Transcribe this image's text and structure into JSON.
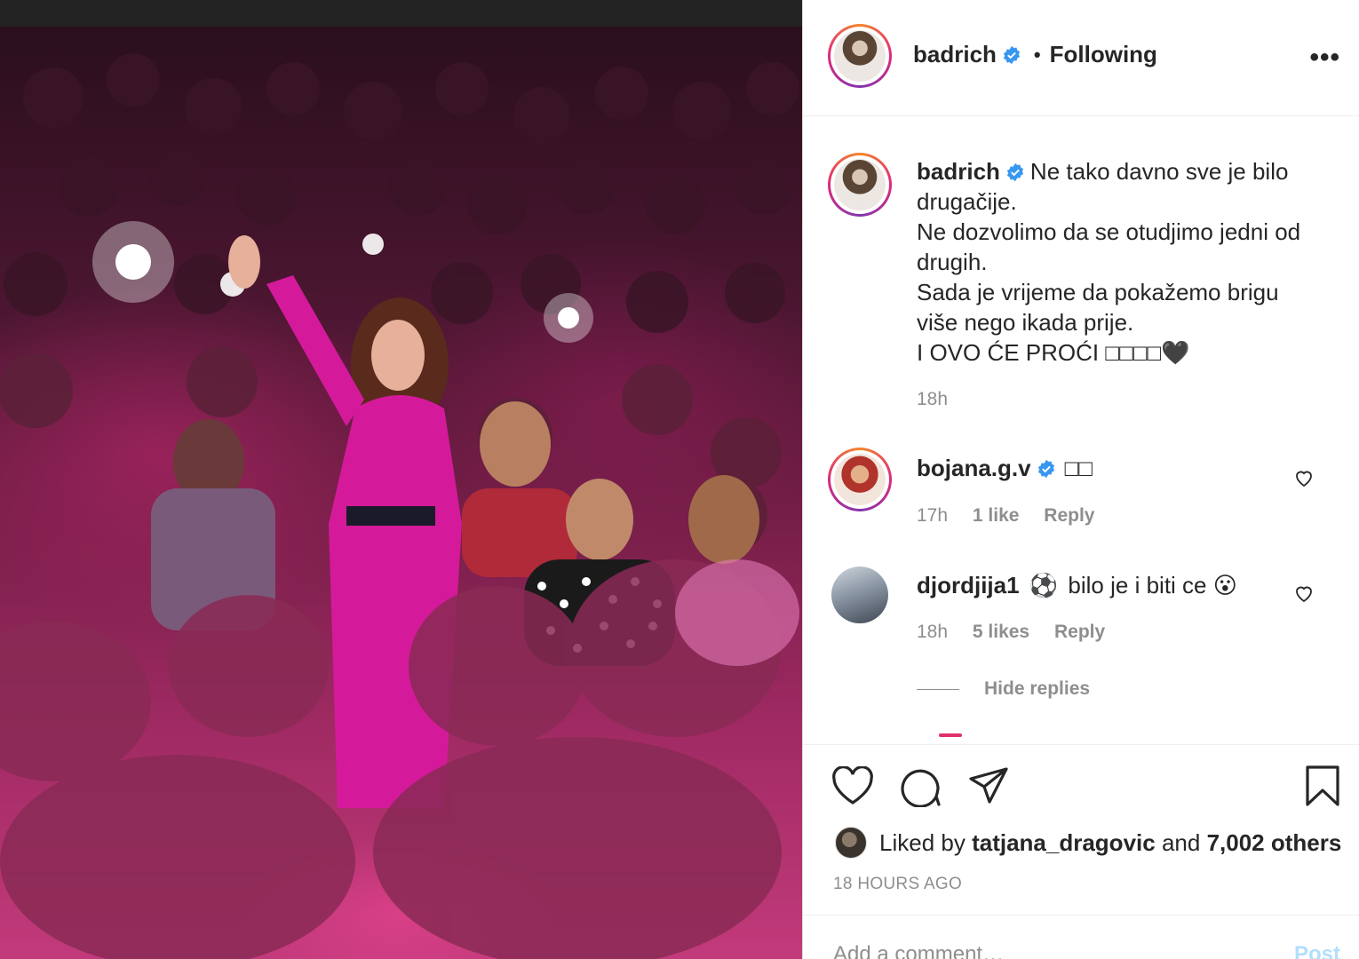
{
  "photo": {
    "alt_icon": "concert-photo"
  },
  "post_header": {
    "username": "badrich",
    "separator": "•",
    "follow_status": "Following",
    "more_label": "•••"
  },
  "caption": {
    "username": "badrich",
    "text": "Ne tako davno sve je bilo\ndrugačije.\nNe dozvolimo da se otudjimo jedni od\ndrugih.\nSada je vrijeme da pokažemo brigu\nviše nego ikada prije.\nI OVO ĆE PROĆI □□□□🖤",
    "time": "18h"
  },
  "comments": [
    {
      "username": "bojana.g.v",
      "text": "□□",
      "time": "17h",
      "likes": "1 like",
      "reply_label": "Reply"
    },
    {
      "username": "djordjija1",
      "text": "bilo je i biti ce 😮",
      "time": "18h",
      "likes": "5 likes",
      "reply_label": "Reply"
    }
  ],
  "hide_replies_label": "Hide replies",
  "likes": {
    "prefix": "Liked by",
    "user": "tatjana_dragovic",
    "conj": "and",
    "others": "7,002 others"
  },
  "timestamp": "18 HOURS AGO",
  "add_comment": {
    "placeholder": "Add a comment…",
    "post_label": "Post"
  },
  "colors": {
    "verified": "#3897f0",
    "link": "#0095f6",
    "muted": "#8e8e8e"
  }
}
